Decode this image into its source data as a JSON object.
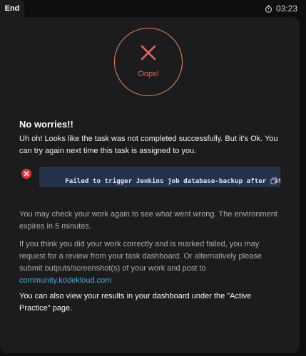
{
  "tab": {
    "label": "End"
  },
  "timer": {
    "icon": "stopwatch-icon",
    "value": "03:23"
  },
  "result": {
    "icon": "x-icon",
    "label": "Oops!",
    "accent_color": "#e46a5f",
    "ring_color": "#e08a5e"
  },
  "content": {
    "heading": "No worries!!",
    "message": "Uh oh! Looks like the task was not completed successfully. But it's Ok. You can try again next time this task is assigned to you.",
    "error": {
      "icon": "error-circle-icon",
      "text": "Failed to trigger Jenkins job database-backup after retries (che\ncrumb/auth and job exists)",
      "copy_icon": "copy-icon"
    },
    "check_work": "You may check your work again to see what went wrong. The environment expires in 5 minutes.",
    "review_text": "If you think you did your work correctly and is marked failed, you may request for a review from your task dashboard. Or alternatively please submit outputs/screenshot(s) of your work and post to ",
    "community_link": "community.kodekloud.com",
    "dashboard_note": "You can also view your results in your dashboard under the \"Active Practice\" page."
  }
}
